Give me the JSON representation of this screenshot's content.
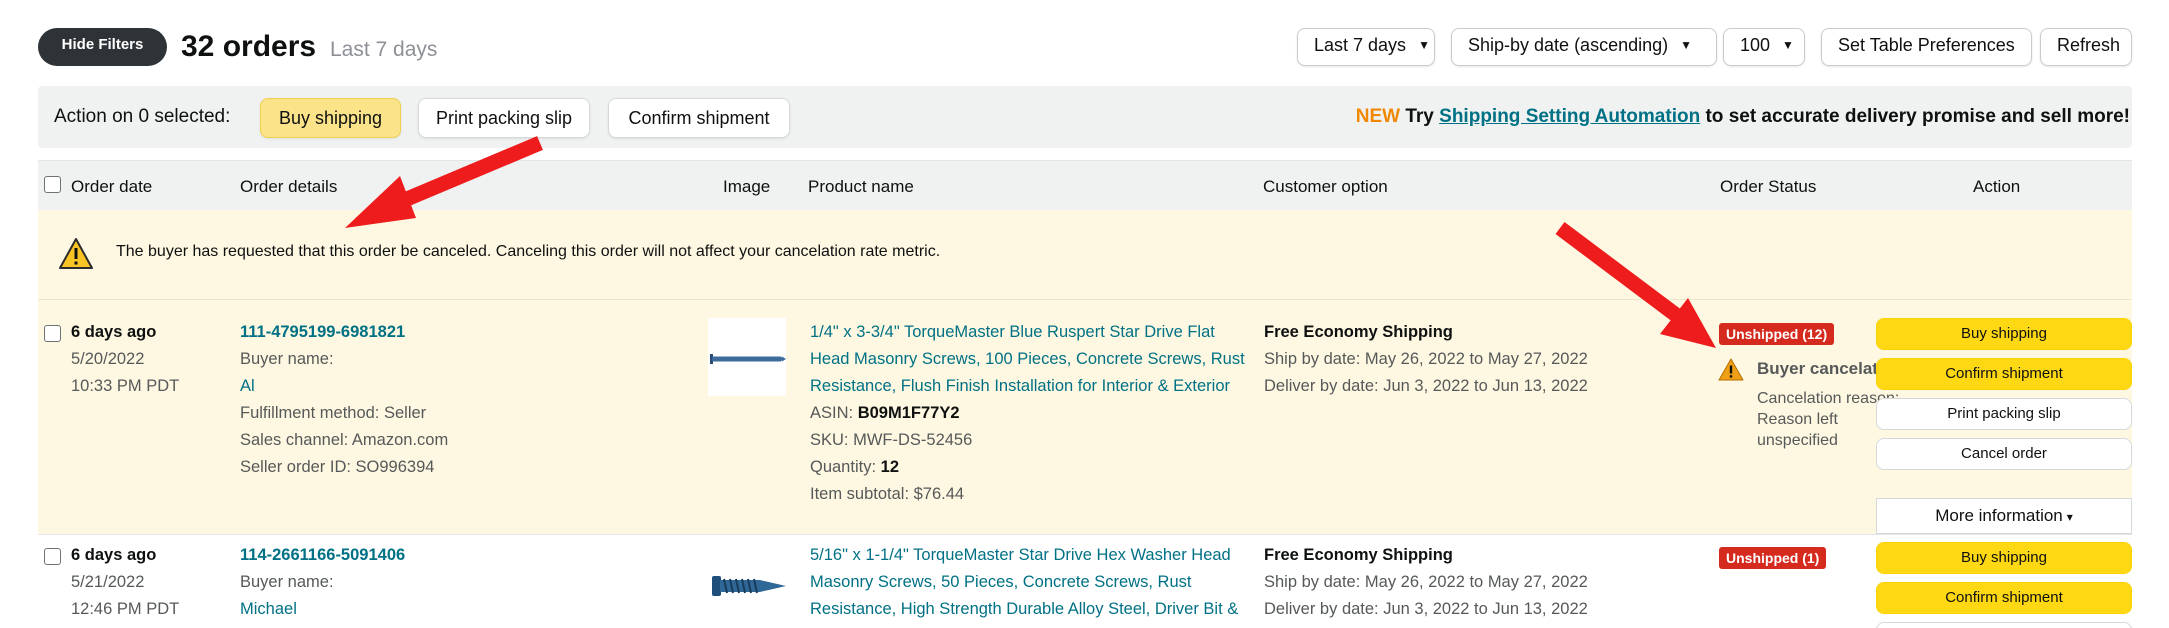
{
  "topbar": {
    "hide_filters": "Hide Filters",
    "orders_count": "32 orders",
    "range": "Last 7 days",
    "date_filter": "Last 7 days",
    "sort": "Ship-by date (ascending)",
    "per_page": "100",
    "table_prefs": "Set Table Preferences",
    "refresh": "Refresh"
  },
  "action_bar": {
    "label": "Action on 0 selected:",
    "buy_shipping": "Buy shipping",
    "print_packing_slip": "Print packing slip",
    "confirm_shipment": "Confirm shipment",
    "promo_new": "NEW",
    "promo_try": "Try",
    "promo_link": "Shipping Setting Automation",
    "promo_rest": "to set accurate delivery promise and sell more!"
  },
  "table": {
    "headers": {
      "order_date": "Order date",
      "order_details": "Order details",
      "image": "Image",
      "product_name": "Product name",
      "customer_option": "Customer option",
      "order_status": "Order Status",
      "action": "Action"
    }
  },
  "notice": {
    "text": "The buyer has requested that this order be canceled. Canceling this order will not affect your cancelation rate metric."
  },
  "orders": [
    {
      "age": "6 days ago",
      "date": "5/20/2022",
      "time": "10:33 PM PDT",
      "order_id": "111-4795199-6981821",
      "buyer_label": "Buyer name:",
      "buyer": "Al",
      "fulfillment": "Fulfillment method: Seller",
      "channel": "Sales channel: Amazon.com",
      "seller_order": "Seller order ID: SO996394",
      "product_lines": [
        "1/4\" x 3-3/4\" TorqueMaster Blue Ruspert Star Drive Flat",
        "Head Masonry Screws, 100 Pieces, Concrete Screws, Rust",
        "Resistance, Flush Finish Installation for Interior & Exterior"
      ],
      "asin_label": "ASIN:",
      "asin": "B09M1F77Y2",
      "sku": "SKU: MWF-DS-52456",
      "quantity_label": "Quantity:",
      "quantity": "12",
      "subtotal": "Item subtotal: $76.44",
      "shipping": "Free Economy Shipping",
      "ship_by": "Ship by date: May 26, 2022 to May 27, 2022",
      "deliver_by": "Deliver by date: Jun 3, 2022 to Jun 13, 2022",
      "status_badge": "Unshipped (12)",
      "status_title": "Buyer cancelation",
      "status_reason_lines": [
        "Cancelation reason:",
        "Reason left",
        "unspecified"
      ],
      "actions": [
        "Buy shipping",
        "Confirm shipment",
        "Print packing slip",
        "Cancel order"
      ],
      "more_info": "More information"
    },
    {
      "age": "6 days ago",
      "date": "5/21/2022",
      "time": "12:46 PM PDT",
      "order_id": "114-2661166-5091406",
      "buyer_label": "Buyer name:",
      "buyer": "Michael",
      "product_lines": [
        "5/16\" x 1-1/4\" TorqueMaster Star Drive Hex Washer Head",
        "Masonry Screws, 50 Pieces, Concrete Screws, Rust",
        "Resistance, High Strength Durable Alloy Steel, Driver Bit &"
      ],
      "shipping": "Free Economy Shipping",
      "ship_by": "Ship by date: May 26, 2022 to May 27, 2022",
      "deliver_by": "Deliver by date: Jun 3, 2022 to Jun 13, 2022",
      "status_badge": "Unshipped (1)",
      "actions": [
        "Buy shipping",
        "Confirm shipment"
      ]
    }
  ],
  "colors": {
    "annotation_arrow": "#ee1c1c",
    "link": "#007185",
    "badge": "#d52b1e",
    "button_yellow": "#ffd814",
    "notice_bg": "#fef8e2"
  }
}
